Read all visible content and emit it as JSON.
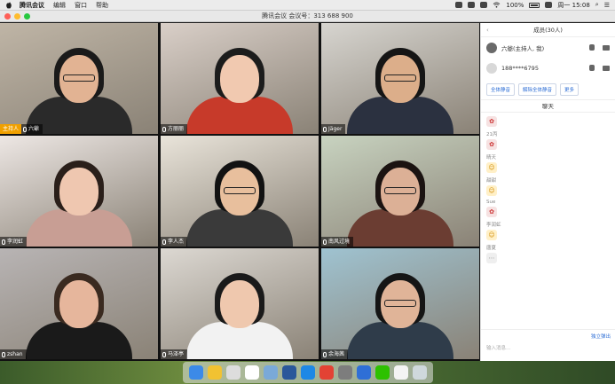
{
  "menubar": {
    "app_name": "腾讯会议",
    "menus": [
      "编辑",
      "窗口",
      "帮助"
    ],
    "battery": "100%",
    "clock": "周一 15:08"
  },
  "window": {
    "title": "腾讯会议 会议号：313 688 900"
  },
  "participants": [
    {
      "name": "六爺",
      "host_tag": "主持人",
      "bg": "#bfb5a6",
      "skin": "#e2b393",
      "hair": "#1a1a1a",
      "shirt": "#2a2a2a",
      "glasses": true
    },
    {
      "name": "方丽丽",
      "bg": "#d9cfc8",
      "skin": "#f1c9b0",
      "hair": "#1c1c1c",
      "shirt": "#c73a2a",
      "glasses": false
    },
    {
      "name": "Jäger",
      "bg": "#d7d5d0",
      "skin": "#dcae8a",
      "hair": "#151515",
      "shirt": "#2b3140",
      "glasses": true
    },
    {
      "name": "李润虹",
      "bg": "#ede7e4",
      "skin": "#efc7b0",
      "hair": "#2a1f1a",
      "shirt": "#c89e94",
      "glasses": false
    },
    {
      "name": "李人杰",
      "bg": "#e9e4da",
      "skin": "#e8bf9d",
      "hair": "#121212",
      "shirt": "#3a3a3a",
      "glasses": true
    },
    {
      "name": "南风过境",
      "bg": "#c8d3c0",
      "skin": "#dcb096",
      "hair": "#1b1311",
      "shirt": "#6b3d32",
      "glasses": true
    },
    {
      "name": "zshan",
      "bg": "#b8b4b4",
      "skin": "#e6b69c",
      "hair": "#3a2a20",
      "shirt": "#1a1a1a",
      "glasses": false
    },
    {
      "name": "马泽亭",
      "bg": "#dcd8d2",
      "skin": "#efc8ae",
      "hair": "#1a1a1a",
      "shirt": "#f2f2f2",
      "glasses": false
    },
    {
      "name": "余海茜",
      "bg": "#9fc3d1",
      "skin": "#e0b498",
      "hair": "#151515",
      "shirt": "#2f3c4a",
      "glasses": true
    }
  ],
  "panel": {
    "members_title": "成员(30人)",
    "members": [
      {
        "name": "六爺(主持人, 我)"
      },
      {
        "name": "188****6795"
      }
    ],
    "buttons": [
      "全体静音",
      "解除全体静音",
      "更多"
    ],
    "chat_title": "聊天",
    "chat": [
      {
        "name": "",
        "sticker": "✿",
        "style": "s-red"
      },
      {
        "name": "21丙",
        "sticker": "✿",
        "style": "s-red"
      },
      {
        "name": "晴天",
        "sticker": "☺",
        "style": "s-yel"
      },
      {
        "name": "甜甜",
        "sticker": "☺",
        "style": "s-yel"
      },
      {
        "name": "Sue",
        "sticker": "✿",
        "style": "s-red"
      },
      {
        "name": "李润虹",
        "sticker": "☺",
        "style": "s-yel"
      },
      {
        "name": "唐夏",
        "sticker": "⋯",
        "style": "s-gray"
      }
    ],
    "pop_out": "独立弹出",
    "input_placeholder": "输入消息..."
  },
  "dock_icons": [
    {
      "name": "finder-icon",
      "color": "#3c8ae8"
    },
    {
      "name": "notes-icon",
      "color": "#f1c232"
    },
    {
      "name": "files-icon",
      "color": "#dddddd"
    },
    {
      "name": "calendar-icon",
      "color": "#ffffff"
    },
    {
      "name": "preview-icon",
      "color": "#7aa9d8"
    },
    {
      "name": "word-icon",
      "color": "#2b579a"
    },
    {
      "name": "safari-icon",
      "color": "#1e88e5"
    },
    {
      "name": "chrome-icon",
      "color": "#e34234"
    },
    {
      "name": "sysprefs-icon",
      "color": "#7d7d7d"
    },
    {
      "name": "meeting-icon",
      "color": "#2f6fd6"
    },
    {
      "name": "wechat-icon",
      "color": "#2dc100"
    },
    {
      "name": "doc-icon",
      "color": "#f4f4f4"
    },
    {
      "name": "trash-icon",
      "color": "#cfd8dc"
    }
  ]
}
